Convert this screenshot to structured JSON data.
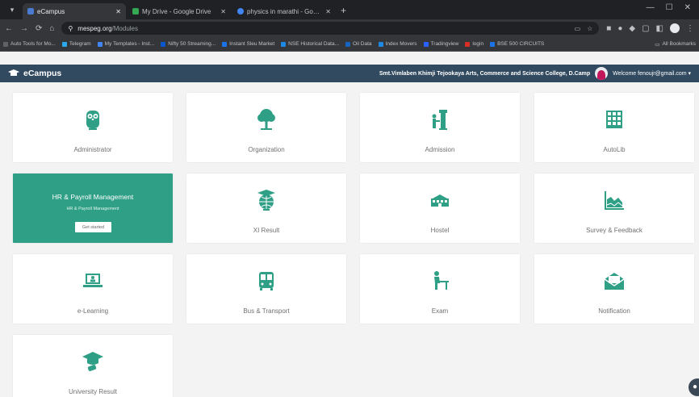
{
  "browser": {
    "tabs": [
      {
        "title": "eCampus",
        "active": true,
        "favicon_color": "#4a7bd1"
      },
      {
        "title": "My Drive - Google Drive",
        "active": false,
        "favicon_color": "#34a853"
      },
      {
        "title": "physics in marathi - Google Se",
        "active": false,
        "favicon_color": "#4285f4"
      }
    ],
    "url_host": "mespeg.org",
    "url_path": "/Modules",
    "bookmarks": [
      {
        "label": "Auto Tools for Mo...",
        "color": "#5f6368"
      },
      {
        "label": "Telegram",
        "color": "#29a9eb"
      },
      {
        "label": "My Templates - Inst...",
        "color": "#4285f4"
      },
      {
        "label": "Nifty 50 Streaming...",
        "color": "#0b57d0"
      },
      {
        "label": "Instant Sleu Market",
        "color": "#1a73e8"
      },
      {
        "label": "NSE Historical Data...",
        "color": "#1e88e5"
      },
      {
        "label": "Oil Data",
        "color": "#1565c0"
      },
      {
        "label": "Index Movers",
        "color": "#1e88e5"
      },
      {
        "label": "Tradingview",
        "color": "#2962ff"
      },
      {
        "label": "login",
        "color": "#d93025"
      },
      {
        "label": "BSE 500 CIRCUITS",
        "color": "#1a73e8"
      }
    ],
    "all_bookmarks": "All Bookmarks"
  },
  "header": {
    "brand": "eCampus",
    "college": "Smt.Vimlaben Khimji Tejookaya Arts, Commerce and Science College, D.Camp",
    "welcome": "Welcome fenoujr@gmail.com ▾"
  },
  "modules": [
    {
      "label": "Administrator",
      "icon": "owl-icon"
    },
    {
      "label": "Organization",
      "icon": "tree-icon"
    },
    {
      "label": "Admission",
      "icon": "admission-icon"
    },
    {
      "label": "AutoLib",
      "icon": "library-icon"
    },
    {
      "label": "HR & Payroll Management",
      "icon": "none"
    },
    {
      "label": "XI Result",
      "icon": "globe-cap-icon"
    },
    {
      "label": "Hostel",
      "icon": "building-icon"
    },
    {
      "label": "Survey & Feedback",
      "icon": "chart-icon"
    },
    {
      "label": "e-Learning",
      "icon": "laptop-icon"
    },
    {
      "label": "Bus & Transport",
      "icon": "bus-icon"
    },
    {
      "label": "Exam",
      "icon": "student-desk-icon"
    },
    {
      "label": "Notification",
      "icon": "envelope-icon"
    },
    {
      "label": "University Result",
      "icon": "graduation-icon"
    }
  ],
  "highlight": {
    "title": "HR & Payroll Management",
    "subtitle": "HR & Payroll Management",
    "button": "Get started"
  },
  "colors": {
    "accent": "#2f9f86",
    "header_bg": "#324a5f"
  }
}
